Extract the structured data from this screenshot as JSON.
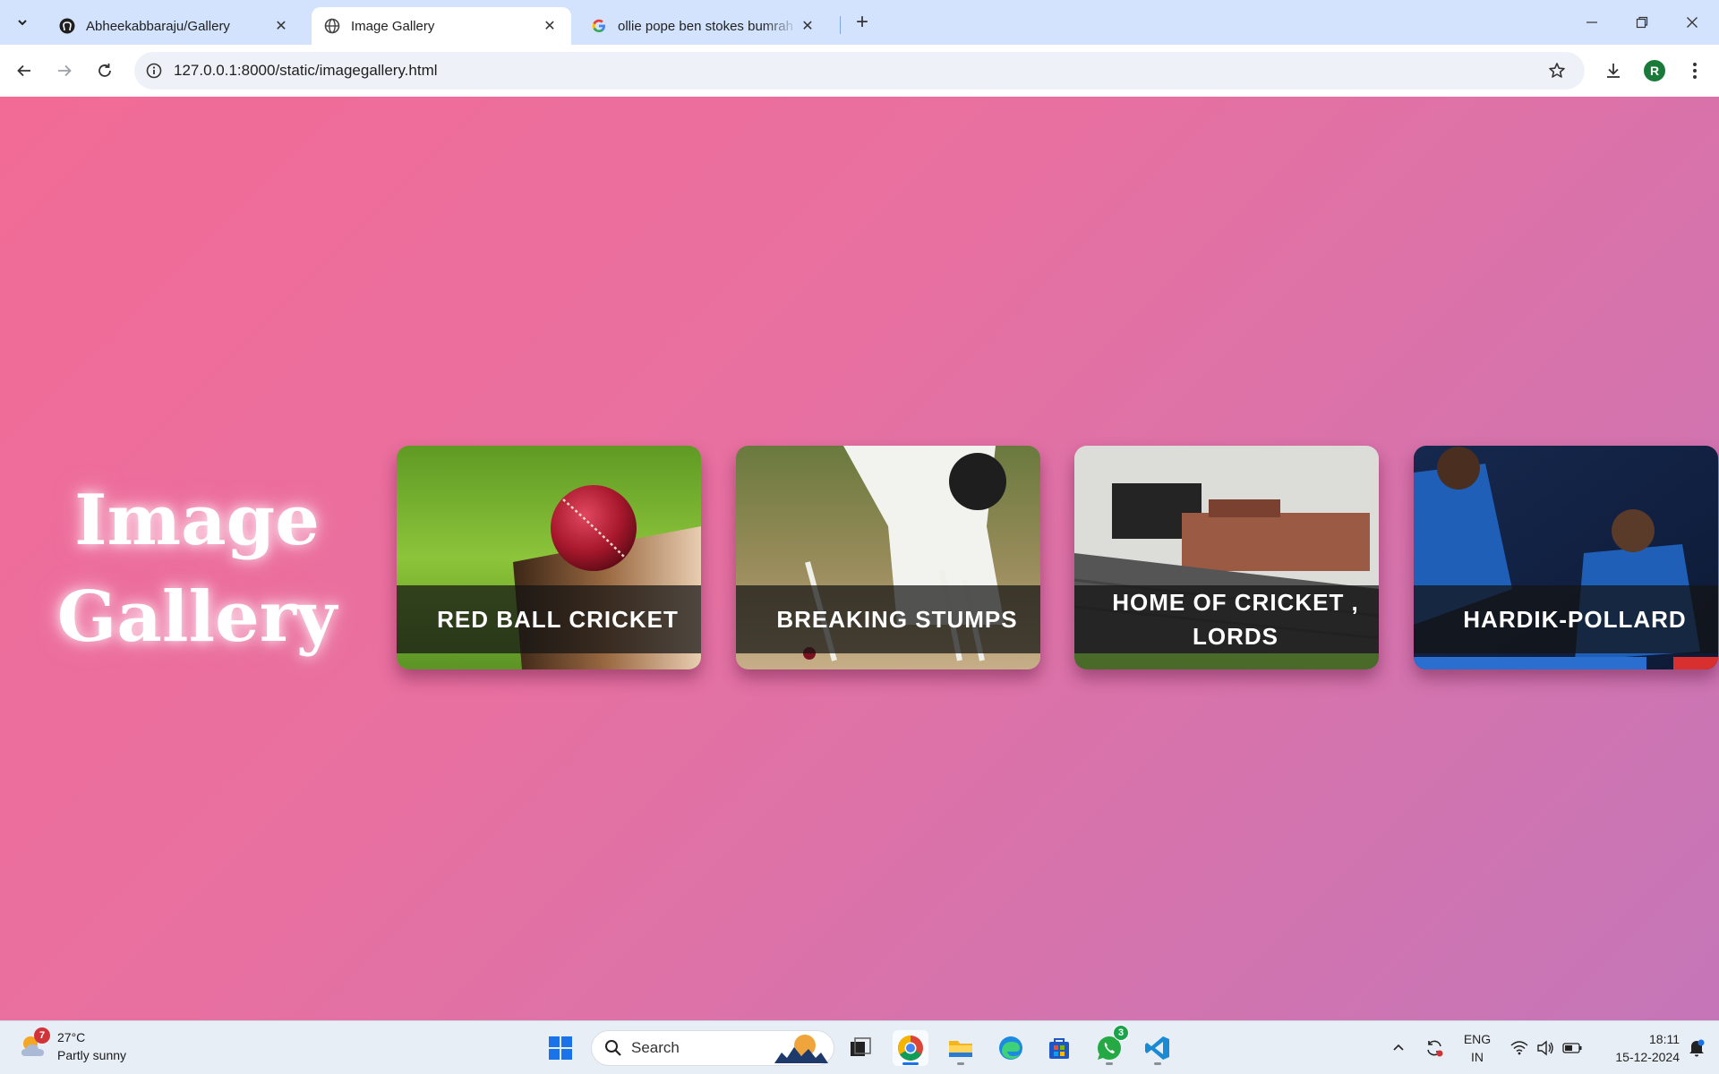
{
  "browser": {
    "tabs": [
      {
        "title": "Abheekabbaraju/Gallery",
        "favicon": "github-icon",
        "active": false
      },
      {
        "title": "Image Gallery",
        "favicon": "globe-icon",
        "active": true
      },
      {
        "title": "ollie pope ben stokes bumrah b",
        "favicon": "google-icon",
        "active": false
      }
    ],
    "url": "127.0.0.1:8000/static/imagegallery.html",
    "profile_initial": "R"
  },
  "page": {
    "title_line1": "Image",
    "title_line2": "Gallery",
    "cards": [
      {
        "caption": "RED BALL CRICKET"
      },
      {
        "caption": "BREAKING STUMPS"
      },
      {
        "caption": "HOME OF CRICKET , LORDS"
      },
      {
        "caption": "HARDIK-POLLARD"
      }
    ]
  },
  "taskbar": {
    "weather_temp": "27°C",
    "weather_desc": "Partly sunny",
    "weather_badge": "7",
    "search_label": "Search",
    "whatsapp_badge": "3",
    "lang_line1": "ENG",
    "lang_line2": "IN",
    "time": "18:11",
    "date": "15-12-2024"
  },
  "colors": {
    "page_gradient_start": "#f26b96",
    "page_gradient_end": "#c576b8",
    "tabstrip": "#d3e3fd"
  }
}
